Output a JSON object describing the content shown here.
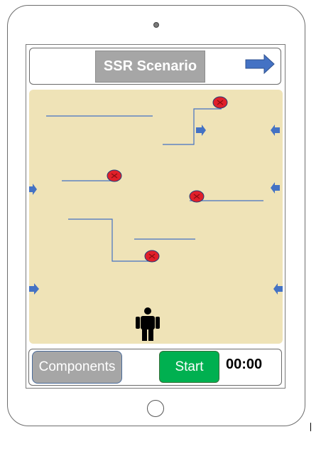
{
  "header": {
    "title": "SSR Scenario",
    "next_icon": "right-arrow-icon"
  },
  "footer": {
    "components_label": "Components",
    "start_label": "Start",
    "timer": "00:00"
  },
  "colors": {
    "canvas": "#efe3b7",
    "wall": "#4472c4",
    "hazard": "#e0202a",
    "start": "#00b050",
    "button_gray": "#a6a6a6"
  },
  "scene": {
    "person_icon": "person-icon",
    "hazard_icon": "hazard-marker-icon",
    "entry_icon": "entry-arrow-icon"
  }
}
